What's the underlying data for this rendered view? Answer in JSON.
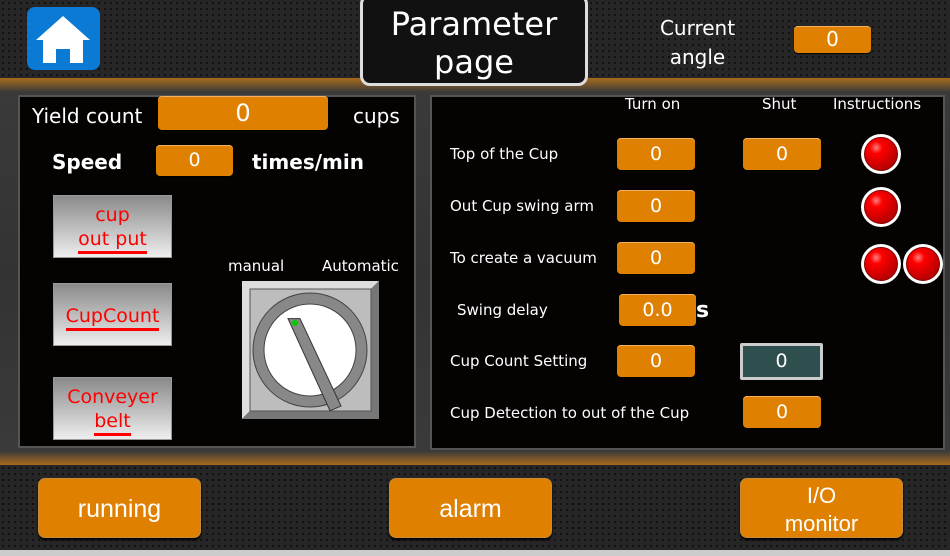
{
  "header": {
    "title": "Parameter page",
    "home_icon": "home-icon",
    "current_angle_label": "Current angle",
    "current_angle_value": "0"
  },
  "left_panel": {
    "yield_count_label": "Yield count",
    "yield_count_value": "0",
    "yield_unit": "cups",
    "speed_label": "Speed",
    "speed_value": "0",
    "speed_unit": "times/min",
    "buttons": [
      {
        "line1": "cup",
        "line2": "out put"
      },
      {
        "line1": "CupCount",
        "line2": ""
      },
      {
        "line1": "Conveyer",
        "line2": "belt"
      }
    ],
    "switch": {
      "left_label": "manual",
      "right_label": "Automatic",
      "position": "manual"
    }
  },
  "right_panel": {
    "headers": {
      "turn_on": "Turn on",
      "shut": "Shut",
      "instructions": "Instructions"
    },
    "rows": [
      {
        "label": "Top of the Cup",
        "turn_on": "0",
        "shut": "0",
        "lamps": 1
      },
      {
        "label": "Out Cup swing arm",
        "turn_on": "0",
        "lamps": 1
      },
      {
        "label": "To create a vacuum",
        "turn_on": "0",
        "lamps": 2
      },
      {
        "label": "Swing delay",
        "turn_on": "0.0",
        "unit": "s"
      },
      {
        "label": "Cup Count Setting",
        "turn_on": "0",
        "shut": "0"
      },
      {
        "label": "Cup Detection to out of the Cup",
        "shut": "0"
      }
    ],
    "lamp_color": "#e00000"
  },
  "footer": {
    "running": "running",
    "alarm": "alarm",
    "io_line1": "I/O",
    "io_line2": "monitor"
  },
  "colors": {
    "accent": "#e08000",
    "home": "#0a7ad4"
  }
}
